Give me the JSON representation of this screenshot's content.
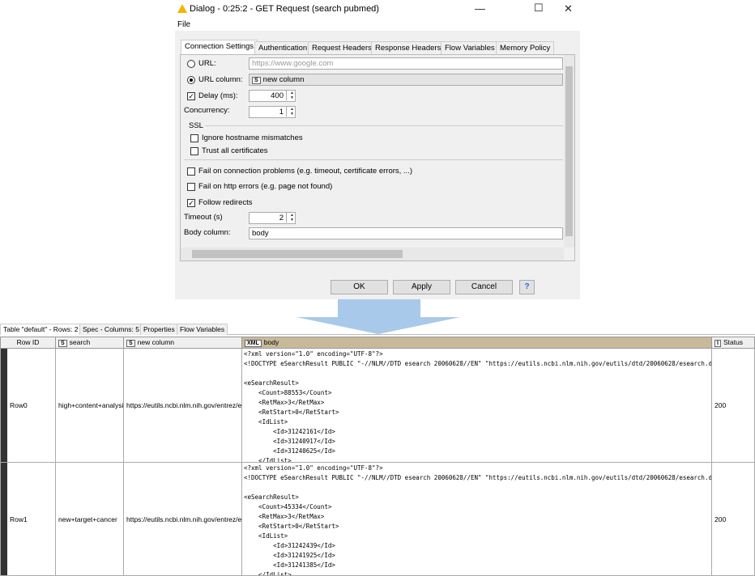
{
  "dialog": {
    "title": "Dialog - 0:25:2 - GET Request (search pubmed)",
    "menu": "File",
    "tabs": [
      "Connection Settings",
      "Authentication",
      "Request Headers",
      "Response Headers",
      "Flow Variables",
      "Memory Policy"
    ],
    "url_label": "URL:",
    "url_placeholder": "https://www.google.com",
    "url_column_label": "URL column:",
    "url_column_value": "new column",
    "url_column_type": "S",
    "delay_label": "Delay (ms):",
    "delay_value": "400",
    "delay_checked": true,
    "concurrency_label": "Concurrency:",
    "concurrency_value": "1",
    "ssl_label": "SSL",
    "ignore_hostname": "Ignore hostname mismatches",
    "trust_all": "Trust all certificates",
    "fail_connection": "Fail on connection problems (e.g. timeout, certificate errors, ...)",
    "fail_http": "Fail on http errors (e.g. page not found)",
    "follow_redirects": "Follow redirects",
    "follow_checked": true,
    "timeout_label": "Timeout (s)",
    "timeout_value": "2",
    "body_column_label": "Body column:",
    "body_column_value": "body",
    "buttons": {
      "ok": "OK",
      "apply": "Apply",
      "cancel": "Cancel"
    }
  },
  "table": {
    "tabs": [
      "Table \"default\" - Rows: 2",
      "Spec - Columns: 5",
      "Properties",
      "Flow Variables"
    ],
    "headers": {
      "rowid": "Row ID",
      "search": "search",
      "new_column": "new column",
      "body": "body",
      "status": "Status"
    },
    "types": {
      "search": "S",
      "new_column": "S",
      "body": "XML",
      "status": "I"
    },
    "rows": [
      {
        "id": "Row0",
        "search": "high+content+analysis",
        "url": "https://eutils.ncbi.nlm.nih.gov/entrez/e...",
        "status": "200",
        "body": "<?xml version=\"1.0\" encoding=\"UTF-8\"?>\n<!DOCTYPE eSearchResult PUBLIC \"-//NLM//DTD esearch 20060628//EN\" \"https://eutils.ncbi.nlm.nih.gov/eutils/dtd/20060628/esearch.dtd\">\n\n<eSearchResult>\n    <Count>88553</Count>\n    <RetMax>3</RetMax>\n    <RetStart>0</RetStart>\n    <IdList>\n        <Id>31242161</Id>\n        <Id>31240917</Id>\n        <Id>31240625</Id>\n    </IdList>"
      },
      {
        "id": "Row1",
        "search": "new+target+cancer",
        "url": "https://eutils.ncbi.nlm.nih.gov/entrez/e...",
        "status": "200",
        "body": "<?xml version=\"1.0\" encoding=\"UTF-8\"?>\n<!DOCTYPE eSearchResult PUBLIC \"-//NLM//DTD esearch 20060628//EN\" \"https://eutils.ncbi.nlm.nih.gov/eutils/dtd/20060628/esearch.dtd\">\n\n<eSearchResult>\n    <Count>45334</Count>\n    <RetMax>3</RetMax>\n    <RetStart>0</RetStart>\n    <IdList>\n        <Id>31242439</Id>\n        <Id>31241925</Id>\n        <Id>31241385</Id>\n    </IdList>"
      }
    ]
  }
}
